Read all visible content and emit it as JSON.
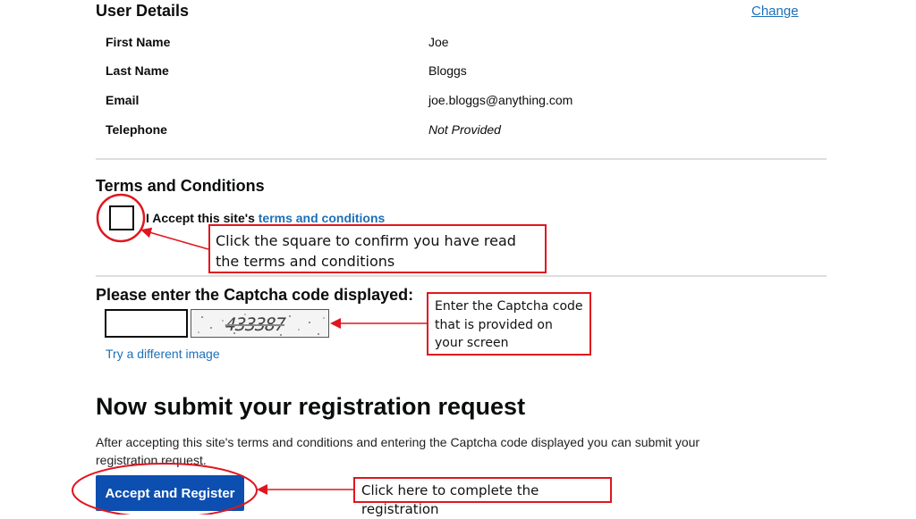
{
  "user_details": {
    "title": "User Details",
    "change_link": "Change",
    "rows": [
      {
        "label": "First Name",
        "value": "Joe"
      },
      {
        "label": "Last Name",
        "value": "Bloggs"
      },
      {
        "label": "Email",
        "value": "joe.bloggs@anything.com"
      },
      {
        "label": "Telephone",
        "value": "Not Provided"
      }
    ]
  },
  "terms": {
    "title": "Terms and Conditions",
    "accept_prefix": "I Accept this site's ",
    "accept_link": "terms and conditions",
    "checked": false,
    "callout": "Click the square to confirm you have read the terms and conditions"
  },
  "captcha": {
    "title": "Please enter the Captcha code displayed:",
    "input_value": "",
    "image_text": "433387",
    "try_different": "Try a different image",
    "callout": "Enter the Captcha code that is provided on your screen"
  },
  "submit": {
    "title": "Now submit your registration request",
    "description": "After accepting this site's terms and conditions and entering the Captcha code displayed you can submit your registration request.",
    "button_label": "Accept and Register",
    "callout": "Click here to complete the registration"
  },
  "colors": {
    "annotation_red": "#e0161f",
    "link_blue": "#1d70b8",
    "button_blue": "#0d4fb0"
  }
}
